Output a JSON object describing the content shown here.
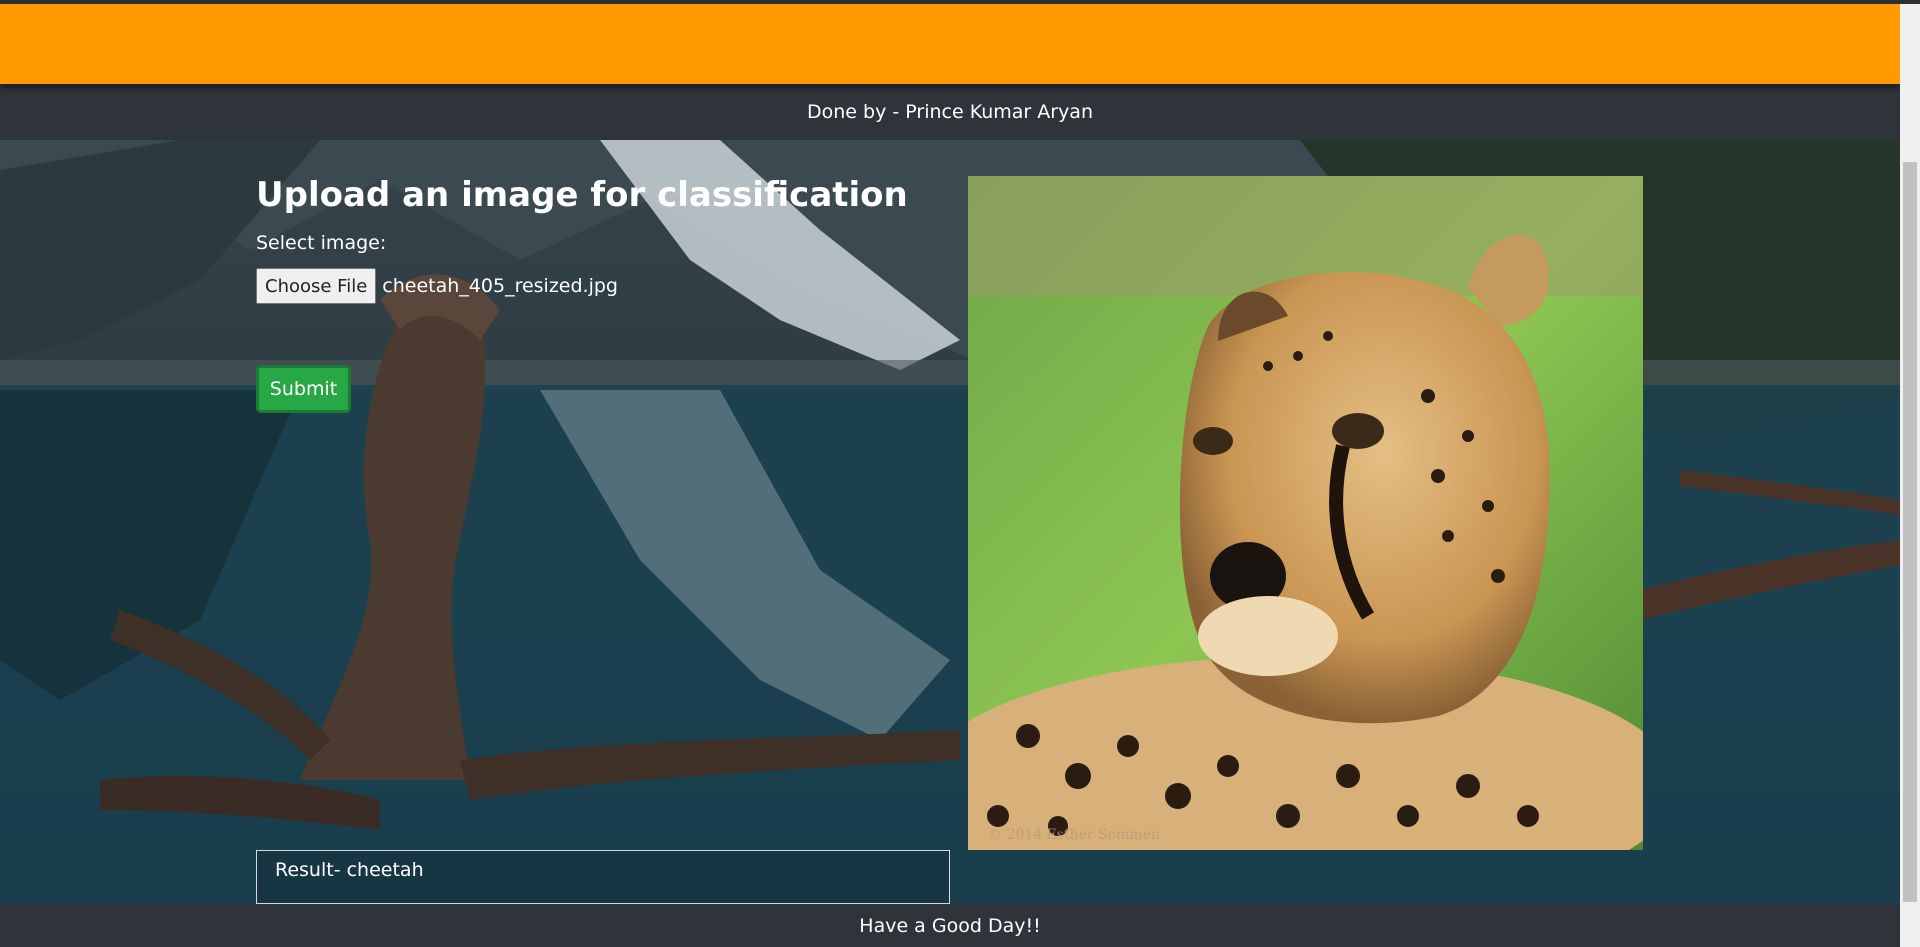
{
  "header": {
    "credit": "Done by - Prince Kumar Aryan",
    "brand_color": "#ff9a00"
  },
  "form": {
    "heading": "Upload an image for classification",
    "select_label": "Select image:",
    "choose_file_label": "Choose File",
    "file_name": "cheetah_405_resized.jpg",
    "submit_label": "Submit"
  },
  "preview": {
    "icon": "cheetah-photo",
    "watermark": "© 2014 Esther Sommen"
  },
  "result": {
    "text": "Result- cheetah"
  },
  "footer": {
    "message": "Have a Good Day!!"
  }
}
